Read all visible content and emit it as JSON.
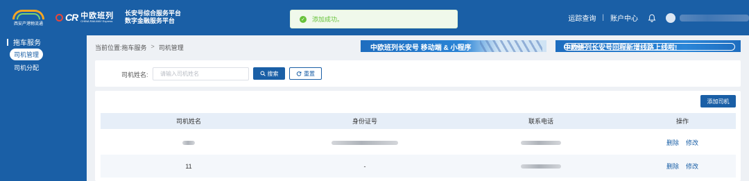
{
  "header": {
    "logo_text": "西安产港物流通",
    "cr_logo": "CR",
    "cr_title": "中欧班列",
    "cr_subtitle": "CHINA RAILWAY Express",
    "platform_line1": "长安号综合服务平台",
    "platform_line2": "数字金融服务平台",
    "nav_tracking": "运踪查询",
    "nav_separator": "|",
    "nav_account": "账户中心"
  },
  "toast": {
    "message": "添加成功。"
  },
  "sidebar": {
    "group_title": "拖车服务",
    "items": [
      {
        "label": "司机管理",
        "active": true
      },
      {
        "label": "司机分配",
        "active": false
      }
    ]
  },
  "breadcrumb": {
    "prefix": "当前位置:",
    "level1": "拖车服务",
    "separator": ">",
    "level2": "司机管理"
  },
  "banners": [
    {
      "text": "中欧班列长安号 移动端 & 小程序"
    },
    {
      "text": "中欧班列长安号回程新增线路上线啦!",
      "tag": "立即体验>"
    }
  ],
  "search": {
    "label": "司机姓名:",
    "placeholder": "请输入司机姓名",
    "search_button": "搜索",
    "reset_button": "重置"
  },
  "table": {
    "add_button": "添加司机",
    "columns": [
      "司机姓名",
      "身份证号",
      "联系电话",
      "操作"
    ],
    "rows": [
      {
        "name": "",
        "id_number": "",
        "phone": ""
      },
      {
        "name": "11",
        "id_number": "-",
        "phone": ""
      }
    ],
    "actions": {
      "delete": "删除",
      "edit": "修改"
    }
  },
  "colors": {
    "primary": "#1a5fa6",
    "success": "#67c23a",
    "header_bg": "#1a5fa6"
  }
}
